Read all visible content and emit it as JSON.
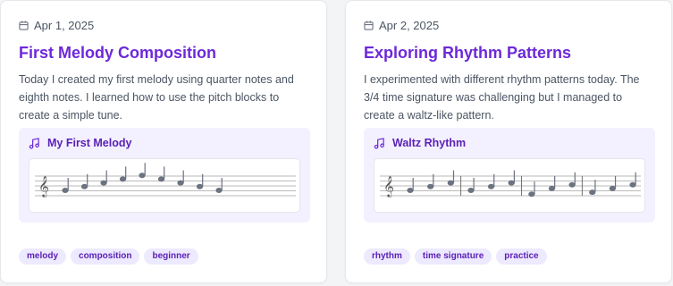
{
  "colors": {
    "accent": "#6d28d9",
    "tag_bg": "#ede9fe",
    "score_bg": "#f3f0ff",
    "note": "#6b7280"
  },
  "entries": [
    {
      "date": "Apr 1, 2025",
      "title": "First Melody Composition",
      "description": "Today I created my first melody using quarter notes and eighth notes. I learned how to use the pitch blocks to create a simple tune.",
      "score_title": "My First Melody",
      "notes": [
        {
          "pitch_step": 0,
          "bar_after": false
        },
        {
          "pitch_step": 1,
          "bar_after": false
        },
        {
          "pitch_step": 2,
          "bar_after": false
        },
        {
          "pitch_step": 3,
          "bar_after": false
        },
        {
          "pitch_step": 4,
          "bar_after": false
        },
        {
          "pitch_step": 3,
          "bar_after": false
        },
        {
          "pitch_step": 2,
          "bar_after": false
        },
        {
          "pitch_step": 1,
          "bar_after": false
        },
        {
          "pitch_step": 0,
          "bar_after": false
        }
      ],
      "tags": [
        "melody",
        "composition",
        "beginner"
      ]
    },
    {
      "date": "Apr 2, 2025",
      "title": "Exploring Rhythm Patterns",
      "description": "I experimented with different rhythm patterns today. The 3/4 time signature was challenging but I managed to create a waltz-like pattern.",
      "score_title": "Waltz Rhythm",
      "notes": [
        {
          "pitch_step": 0,
          "bar_after": false
        },
        {
          "pitch_step": 1,
          "bar_after": false
        },
        {
          "pitch_step": 2,
          "bar_after": true
        },
        {
          "pitch_step": 0,
          "bar_after": false
        },
        {
          "pitch_step": 1,
          "bar_after": false
        },
        {
          "pitch_step": 2,
          "bar_after": true
        },
        {
          "pitch_step": -1,
          "bar_after": false
        },
        {
          "pitch_step": 0.5,
          "bar_after": false
        },
        {
          "pitch_step": 1.5,
          "bar_after": true
        },
        {
          "pitch_step": -0.5,
          "bar_after": false
        },
        {
          "pitch_step": 0.5,
          "bar_after": false
        },
        {
          "pitch_step": 1.5,
          "bar_after": false
        }
      ],
      "tags": [
        "rhythm",
        "time signature",
        "practice"
      ]
    }
  ]
}
